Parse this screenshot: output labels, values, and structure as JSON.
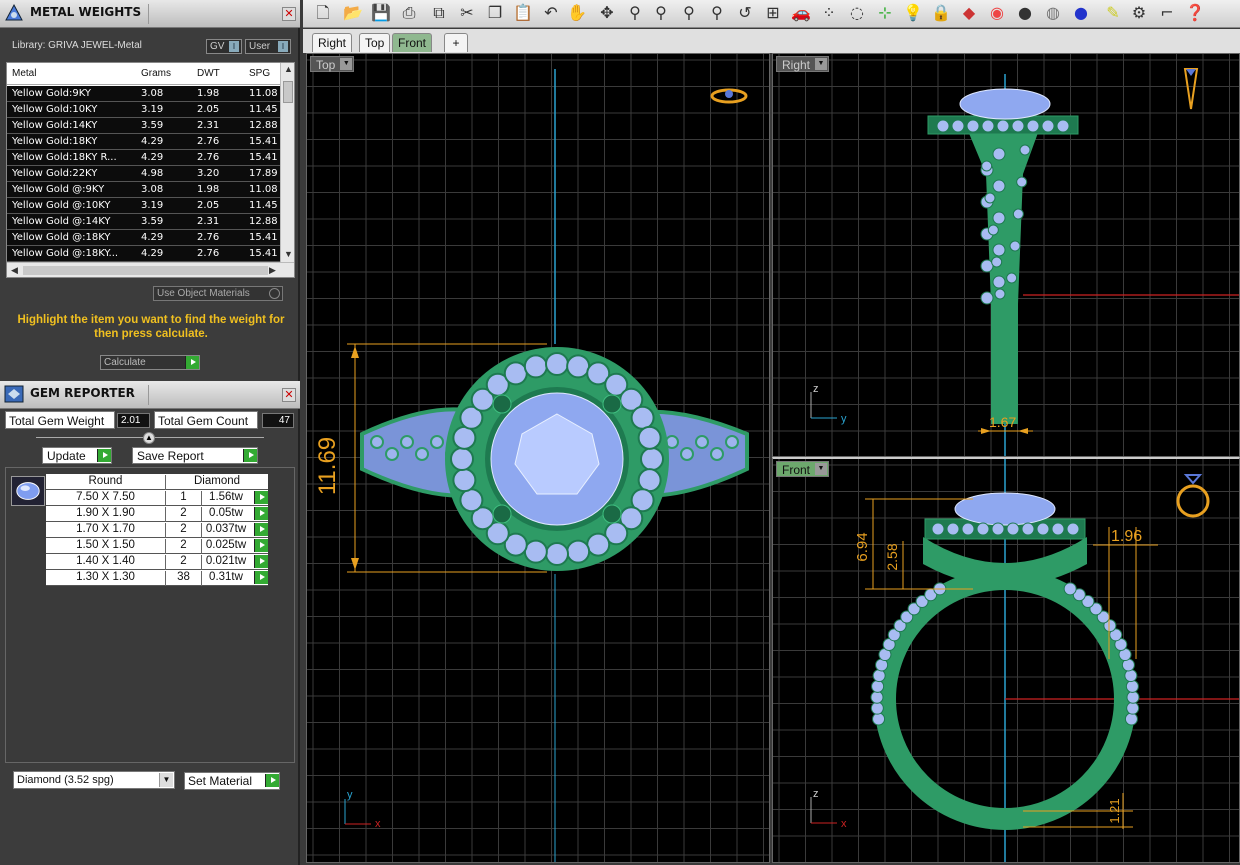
{
  "metal_weights": {
    "title": "METAL WEIGHTS",
    "library": "Library: GRIVA JEWEL-Metal",
    "gv_label": "GV",
    "user_label": "User",
    "columns": [
      "Metal",
      "Grams",
      "DWT",
      "SPG"
    ],
    "rows": [
      [
        "Yellow Gold:9KY",
        "3.08",
        "1.98",
        "11.08"
      ],
      [
        "Yellow Gold:10KY",
        "3.19",
        "2.05",
        "11.45"
      ],
      [
        "Yellow Gold:14KY",
        "3.59",
        "2.31",
        "12.88"
      ],
      [
        "Yellow Gold:18KY",
        "4.29",
        "2.76",
        "15.41"
      ],
      [
        "Yellow Gold:18KY R...",
        "4.29",
        "2.76",
        "15.41"
      ],
      [
        "Yellow Gold:22KY",
        "4.98",
        "3.20",
        "17.89"
      ],
      [
        "Yellow Gold @:9KY",
        "3.08",
        "1.98",
        "11.08"
      ],
      [
        "Yellow Gold @:10KY",
        "3.19",
        "2.05",
        "11.45"
      ],
      [
        "Yellow Gold @:14KY",
        "3.59",
        "2.31",
        "12.88"
      ],
      [
        "Yellow Gold @:18KY",
        "4.29",
        "2.76",
        "15.41"
      ],
      [
        "Yellow Gold @:18KY...",
        "4.29",
        "2.76",
        "15.41"
      ]
    ],
    "use_object_materials": "Use Object Materials",
    "hint": "Highlight the item you want to find the weight for then press calculate.",
    "calculate_label": "Calculate"
  },
  "gem_reporter": {
    "title": "GEM REPORTER",
    "total_weight_label": "Total Gem Weight",
    "total_weight_value": "2.01",
    "total_count_label": "Total Gem Count",
    "total_count_value": "47",
    "update_label": "Update",
    "save_label": "Save Report",
    "header": [
      "Round",
      "Diamond"
    ],
    "rows": [
      [
        "7.50 X 7.50",
        "1",
        "1.56tw"
      ],
      [
        "1.90 X 1.90",
        "2",
        "0.05tw"
      ],
      [
        "1.70 X 1.70",
        "2",
        "0.037tw"
      ],
      [
        "1.50 X 1.50",
        "2",
        "0.025tw"
      ],
      [
        "1.40 X 1.40",
        "2",
        "0.021tw"
      ],
      [
        "1.30 X 1.30",
        "38",
        "0.31tw"
      ]
    ],
    "material_value": "Diamond     (3.52 spg)",
    "set_material_label": "Set Material"
  },
  "tabs": [
    "Right",
    "Top",
    "Front",
    "+"
  ],
  "active_tab": 2,
  "viewports": {
    "top": {
      "label": "Top",
      "dimension": "11.69",
      "axis_x": "x",
      "axis_y": "y"
    },
    "right": {
      "label": "Right",
      "dimension": "1.67",
      "axis_x": "y",
      "axis_y": "z"
    },
    "front": {
      "label": "Front",
      "dim_a": "6.94",
      "dim_b": "2.58",
      "dim_c": "1.96",
      "dim_d": "1.21",
      "axis_x": "x",
      "axis_y": "z"
    }
  },
  "colors": {
    "metal": "#2e9b66",
    "gem": "#8fa8f0",
    "dim": "#e8a020",
    "grid": "#3a3a3a"
  }
}
